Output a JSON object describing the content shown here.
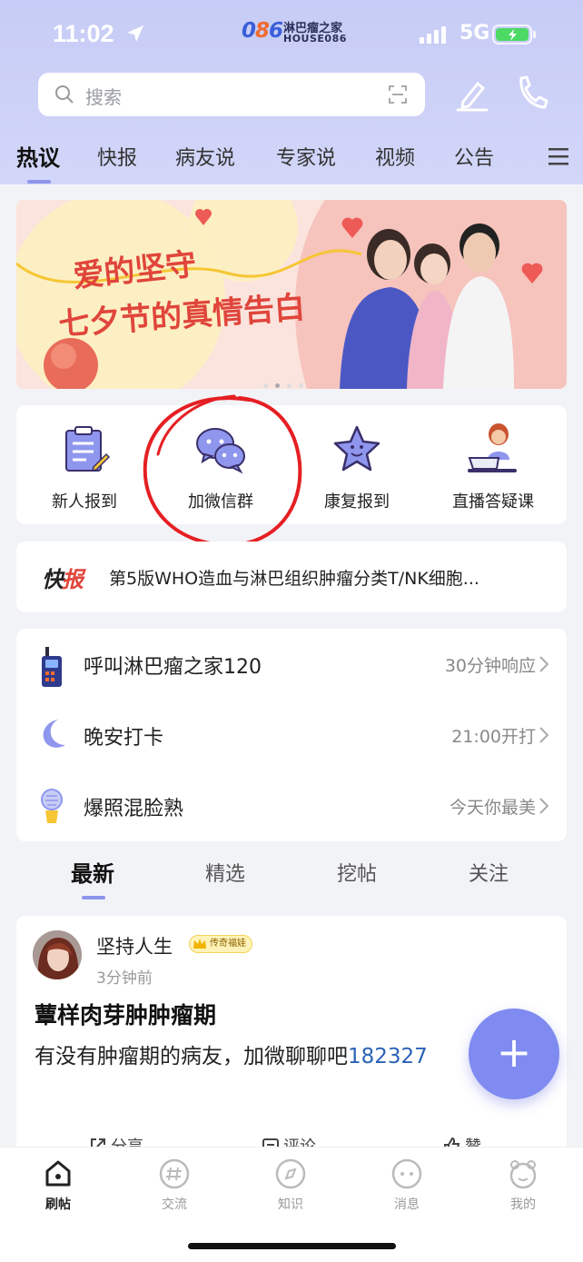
{
  "status": {
    "time": "11:02",
    "network": "5G"
  },
  "app": {
    "logo_mark": "086",
    "logo_cn": "淋巴瘤之家",
    "logo_en": "HOUSE086"
  },
  "search": {
    "placeholder": "搜索"
  },
  "top_tabs": [
    {
      "label": "热议",
      "active": true
    },
    {
      "label": "快报"
    },
    {
      "label": "病友说"
    },
    {
      "label": "专家说"
    },
    {
      "label": "视频"
    },
    {
      "label": "公告"
    }
  ],
  "banner": {
    "line1": "爱的坚守",
    "line2": "七夕节的真情告白",
    "page_index": 2,
    "page_count": 4
  },
  "quick_entries": [
    {
      "label": "新人报到",
      "icon": "clipboard-icon"
    },
    {
      "label": "加微信群",
      "icon": "wechat-icon"
    },
    {
      "label": "康复报到",
      "icon": "star-icon"
    },
    {
      "label": "直播答疑课",
      "icon": "live-teacher-icon"
    }
  ],
  "news_flash": {
    "tag_black": "快",
    "tag_red": "报",
    "text": "第5版WHO造血与淋巴组织肿瘤分类T/NK细胞..."
  },
  "list_rows": [
    {
      "title": "呼叫淋巴瘤之家120",
      "right": "30分钟响应",
      "icon": "walkie-talkie-icon"
    },
    {
      "title": "晚安打卡",
      "right": "21:00开打",
      "icon": "moon-icon"
    },
    {
      "title": "爆照混脸熟",
      "right": "今天你最美",
      "icon": "torch-icon"
    }
  ],
  "feed_tabs": [
    {
      "label": "最新",
      "active": true
    },
    {
      "label": "精选"
    },
    {
      "label": "挖帖"
    },
    {
      "label": "关注"
    }
  ],
  "post": {
    "username": "坚持人生",
    "badge": "传奇福娃",
    "time": "3分钟前",
    "title": "蕈样肉芽肿肿瘤期",
    "body": "有没有肿瘤期的病友，加微聊聊吧",
    "phone": "182327",
    "actions": [
      "分享",
      "评论",
      "赞"
    ]
  },
  "bottom_nav": [
    {
      "label": "刷帖",
      "active": true
    },
    {
      "label": "交流"
    },
    {
      "label": "知识"
    },
    {
      "label": "消息"
    },
    {
      "label": "我的"
    }
  ],
  "colors": {
    "header_bg": "#c7ccf6",
    "accent": "#8d95ec",
    "banner_red": "#e0453b",
    "fab": "#7f8bf0",
    "link_blue": "#2a62b6"
  }
}
